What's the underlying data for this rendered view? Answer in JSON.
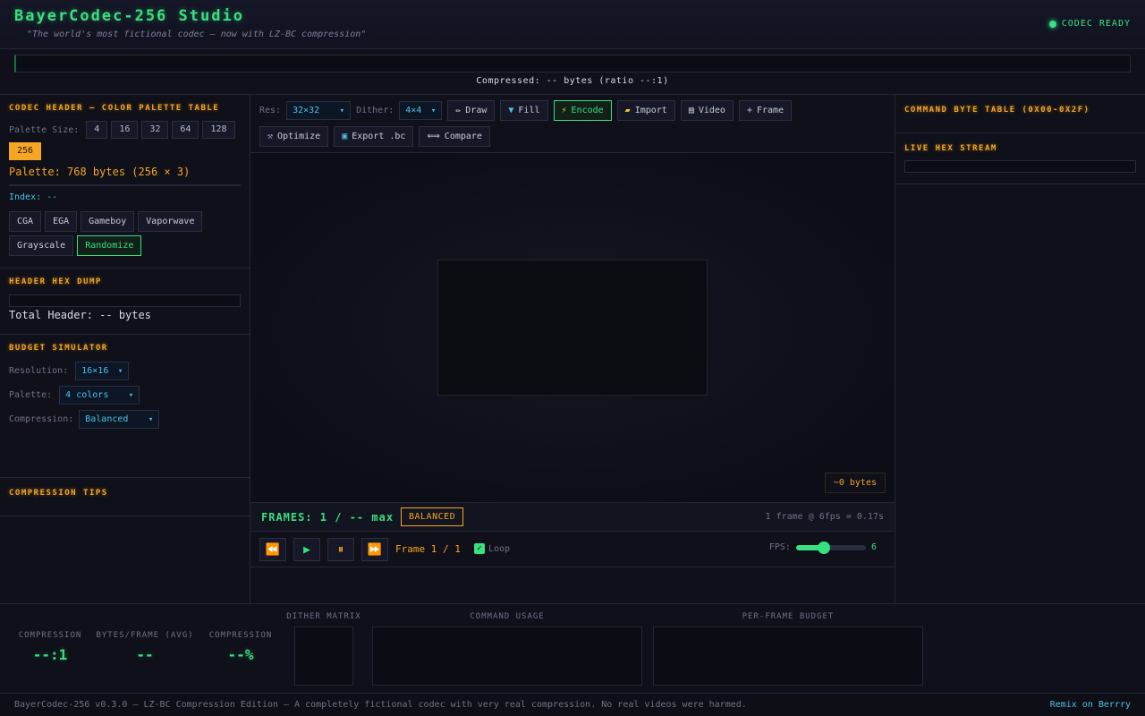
{
  "header": {
    "title": "BayerCodec-256 Studio",
    "subtitle": "\"The world's most fictional codec — now with LZ-BC compression\"",
    "status": "CODEC READY"
  },
  "top": {
    "compressed": "Compressed: -- bytes (ratio --:1)"
  },
  "left": {
    "palette_section": {
      "title": "CODEC HEADER — COLOR PALETTE TABLE",
      "size_label": "Palette Size:",
      "sizes": [
        "4",
        "16",
        "32",
        "64",
        "128",
        "256"
      ],
      "selected_size": "256",
      "palette_bytes": "Palette: 768 bytes (256 × 3)",
      "index_label": "Index: --",
      "presets": [
        "CGA",
        "EGA",
        "Gameboy",
        "Vaporwave",
        "Grayscale",
        "Randomize"
      ]
    },
    "hexdump_section": {
      "title": "HEADER HEX DUMP",
      "total": "Total Header: -- bytes"
    },
    "budget_section": {
      "title": "BUDGET SIMULATOR",
      "resolution_label": "Resolution:",
      "resolution_value": "16×16",
      "palette_label": "Palette:",
      "palette_value": "4 colors",
      "compression_label": "Compression:",
      "compression_value": "Balanced"
    },
    "tips_section": {
      "title": "COMPRESSION TIPS"
    }
  },
  "center": {
    "toolbar": {
      "res_label": "Res:",
      "res_value": "32×32",
      "dither_label": "Dither:",
      "dither_value": "4×4",
      "draw": "Draw",
      "fill": "Fill",
      "encode": "Encode",
      "import": "Import",
      "video": "Video",
      "frame": "Frame",
      "optimize": "Optimize",
      "export": "Export .bc",
      "compare": "Compare"
    },
    "bytes_badge": "~0 bytes",
    "frames_label": "FRAMES: 1 / -- max",
    "mode_badge": "BALANCED",
    "frame_info": "1 frame @ 6fps = 0.17s",
    "frame_counter": "Frame 1 / 1",
    "loop_label": "Loop",
    "fps_label": "FPS:",
    "fps_value": "6",
    "fps_fraction": 0.4
  },
  "right": {
    "command_title": "COMMAND BYTE TABLE (0X00-0X2F)",
    "hex_stream_title": "LIVE HEX STREAM"
  },
  "stats": {
    "compression_ratio_label": "COMPRESSION",
    "compression_ratio_value": "--:1",
    "bytes_per_frame_label": "BYTES/FRAME (AVG)",
    "bytes_per_frame_value": "--",
    "compression_pct_label": "COMPRESSION",
    "compression_pct_value": "--%",
    "dither_matrix_label": "DITHER MATRIX",
    "command_usage_label": "COMMAND USAGE",
    "per_frame_budget_label": "PER-FRAME BUDGET"
  },
  "footer": {
    "text": "BayerCodec-256 v0.3.0 — LZ-BC Compression Edition — A completely fictional codec with very real compression. No real videos were harmed.",
    "link": "Remix on Berrry"
  },
  "colors": {
    "accent_green": "#39e07f",
    "accent_orange": "#f5a623",
    "accent_cyan": "#4cc3e8",
    "background": "#0f1019"
  }
}
